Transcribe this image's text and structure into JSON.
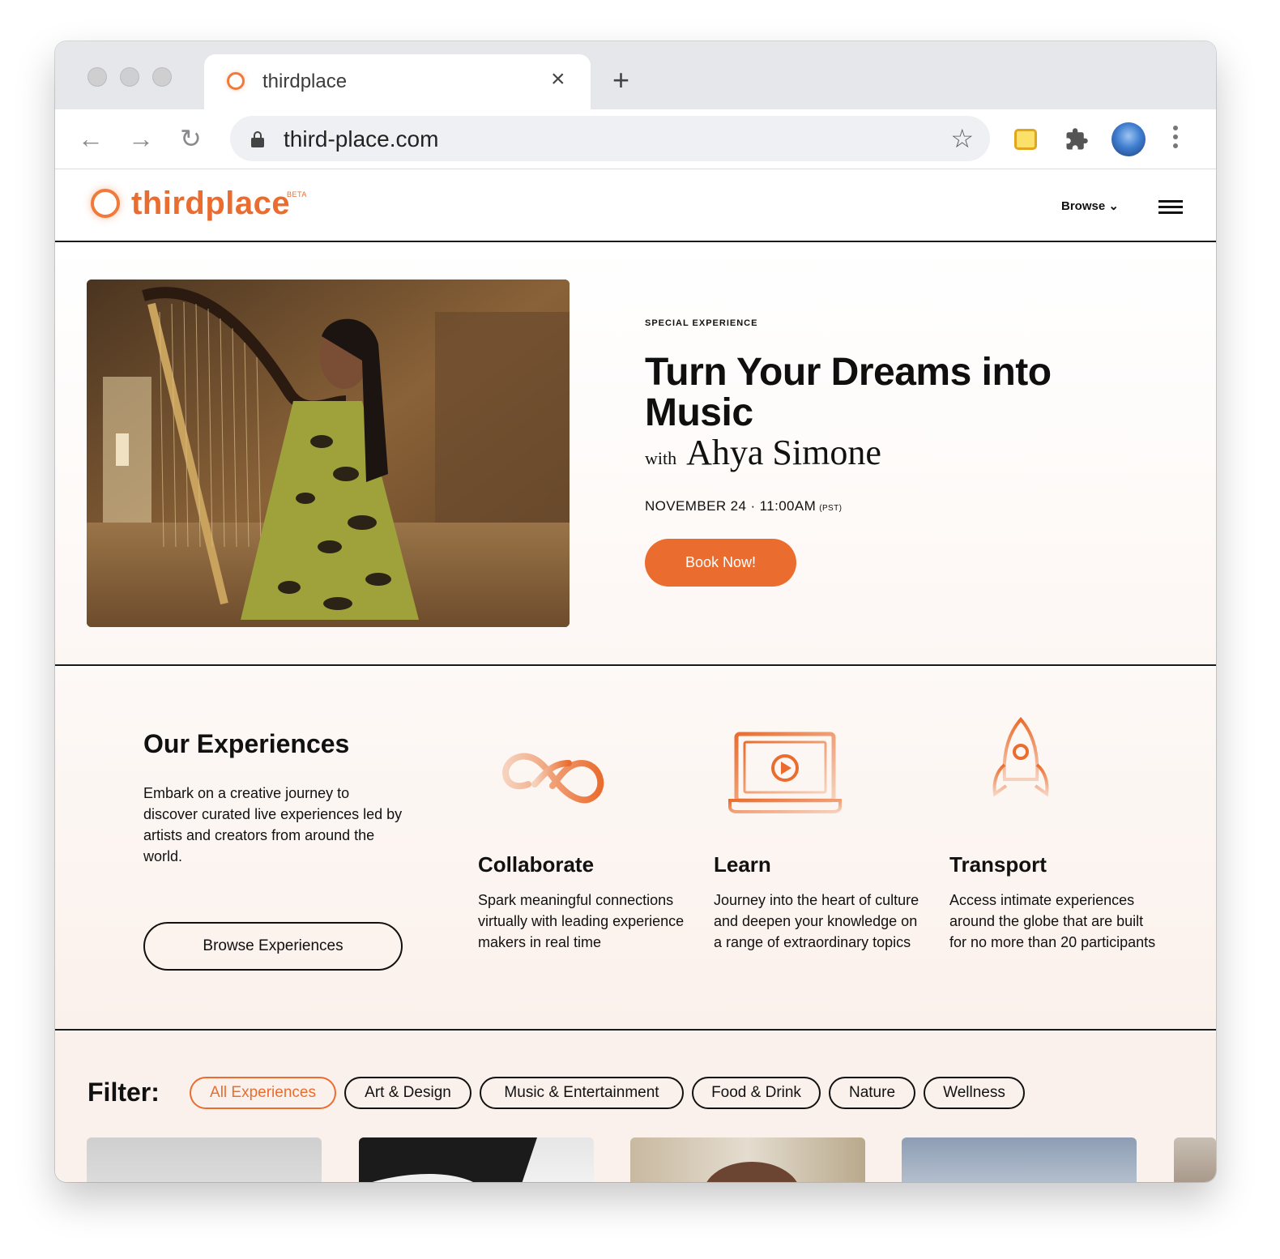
{
  "browser": {
    "tab_title": "thirdplace",
    "tab_close_icon": "×",
    "new_tab_icon": "+",
    "url": "third-place.com",
    "back_icon": "←",
    "forward_icon": "→",
    "reload_icon": "↻",
    "star_icon": "☆",
    "puzzle_icon": "🧩"
  },
  "site": {
    "logo_text": "thirdplace",
    "logo_badge": "BETA",
    "nav_browse": "Browse ⌄"
  },
  "hero": {
    "eyebrow": "SPECIAL EXPERIENCE",
    "title": "Turn Your Dreams into Music",
    "with_word": "with",
    "artist": "Ahya Simone",
    "date": "NOVEMBER 24 · 11:00AM",
    "timezone": "(PST)",
    "cta": "Book Now!"
  },
  "experiences": {
    "title": "Our Experiences",
    "description": "Embark on a creative journey to discover curated live experiences led by artists and creators from around the world.",
    "cta": "Browse Experiences",
    "features": [
      {
        "title": "Collaborate",
        "description": "Spark meaningful connections virtually with leading experience makers in real time",
        "icon": "infinity-icon"
      },
      {
        "title": "Learn",
        "description": "Journey into the heart of culture and deepen your knowledge on a range of extraordinary topics",
        "icon": "laptop-play-icon"
      },
      {
        "title": "Transport",
        "description": "Access intimate experiences around the globe that are built for no more than 20 participants",
        "icon": "rocket-icon"
      }
    ]
  },
  "filters": {
    "label": "Filter:",
    "chips": [
      "All Experiences",
      "Art & Design",
      "Music & Entertainment",
      "Food & Drink",
      "Nature",
      "Wellness"
    ],
    "active": "All Experiences"
  },
  "colors": {
    "brand_orange": "#ea6d2f",
    "ink": "#111111",
    "panel_tint": "#fbf1ec"
  }
}
